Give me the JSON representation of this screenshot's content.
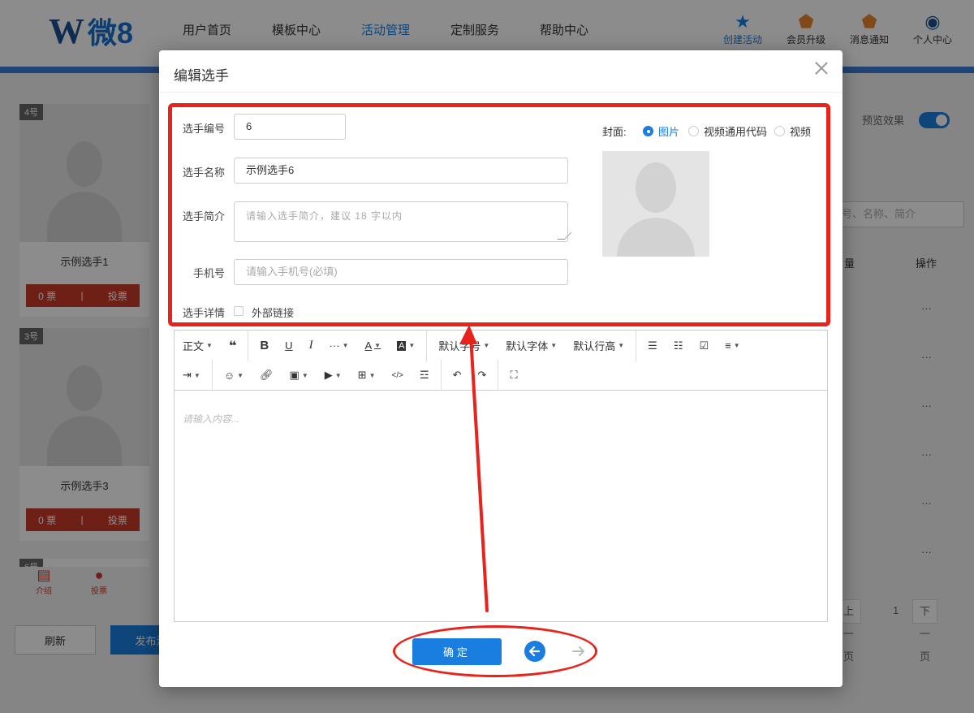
{
  "brand": {
    "mark": "W",
    "text": "微8"
  },
  "main_nav": [
    "用户首页",
    "模板中心",
    "活动管理",
    "定制服务",
    "帮助中心"
  ],
  "right_nav": [
    {
      "label": "创建活动",
      "icon": "star-trophy-icon"
    },
    {
      "label": "会员升级",
      "icon": "shield-badge-icon"
    },
    {
      "label": "消息通知",
      "icon": "shield-badge-icon"
    },
    {
      "label": "个人中心",
      "icon": "user-circle-icon"
    }
  ],
  "background": {
    "cards": [
      {
        "number": "4号",
        "name": "示例选手1",
        "votes": "0 票",
        "vote_btn": "投票"
      },
      {
        "number": "3号",
        "name": "示例选手3",
        "votes": "0 票",
        "vote_btn": "投票"
      },
      {
        "number": "6号"
      }
    ],
    "tabbar": {
      "intro": "介绍",
      "vote": "投票"
    },
    "refresh": "刷新",
    "publish": "发布活",
    "preview": "预览效果",
    "search_placeholder": "号、名称、简介",
    "col_votes": "量",
    "col_actions": "操作",
    "row_actions": "···",
    "prev_page": "上一页",
    "page": "1",
    "next_page": "下一页"
  },
  "modal": {
    "title": "编辑选手",
    "form": {
      "number_label": "选手编号",
      "number_value": "6",
      "name_label": "选手名称",
      "name_value": "示例选手6",
      "intro_label": "选手简介",
      "intro_placeholder": "请输入选手简介，建议 18 字以内",
      "phone_label": "手机号",
      "phone_placeholder": "请输入手机号(必填)",
      "detail_label": "选手详情",
      "external_link": "外部链接"
    },
    "cover": {
      "label": "封面:",
      "options": [
        "图片",
        "视频通用代码",
        "视频"
      ],
      "selected": "图片"
    },
    "editor": {
      "toolbar1": [
        "正文",
        "❝",
        "B",
        "U",
        "I",
        "···",
        "A",
        "A",
        "默认字号",
        "默认字体",
        "默认行高",
        "bulleted-list",
        "numbered-list",
        "checklist",
        "align"
      ],
      "heading": "正文",
      "font_size": "默认字号",
      "font_family": "默认字体",
      "line_height": "默认行高",
      "placeholder": "请输入内容..."
    },
    "confirm": "确定"
  },
  "colors": {
    "accent": "#1a7ee0",
    "annotation": "#e8231b",
    "vote_red": "#c83b28"
  }
}
